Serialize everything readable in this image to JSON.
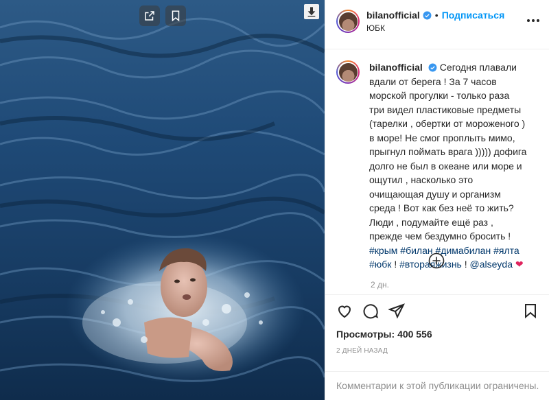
{
  "post": {
    "username": "bilanofficial",
    "follow_label": "Подписаться",
    "separator": "•",
    "location": "ЮБК",
    "caption": {
      "text1": "Сегодня плавали вдали от берега ! За 7 часов морской прогулки - только раза три видел пластиковые предметы (тарелки , обертки от мороженого ) в море! Не смог проплыть мимо, прыгнул поймать врага ))))) дофига долго не был в океане или море и ощутил , насколько это очищающая душу и организм среда ! Вот как без неё то жить? Люди , подумайте ещё раз , прежде чем бездумно бросить !",
      "tag1": "#крым",
      "tag2": "#билан",
      "tag3": "#димабилан",
      "tag4": "#ялта",
      "tag5": "#юбк",
      "text2": "!",
      "tag6": "#втораяжизнь",
      "text3": "!",
      "mention": "@alseyda",
      "heart": "❤"
    },
    "caption_time": "2 дн.",
    "views_label": "Просмотры:",
    "views_count": "400 556",
    "posted_ago": "2 ДНЕЙ НАЗАД",
    "comments_disabled": "Комментарии к этой публикации ограничены."
  },
  "icons": {
    "media": [
      "share-icon",
      "bookmark-icon",
      "download-icon"
    ],
    "header": [
      "verified-icon",
      "more-options-icon"
    ],
    "actions": [
      "heart-icon",
      "comment-icon",
      "send-icon",
      "save-icon",
      "load-more-icon"
    ]
  },
  "colors": {
    "link_blue": "#0095f6",
    "tag_blue": "#00376b",
    "muted_gray": "#8e8e8e",
    "heart_red": "#e0245e",
    "sea": "#1c3f66"
  }
}
